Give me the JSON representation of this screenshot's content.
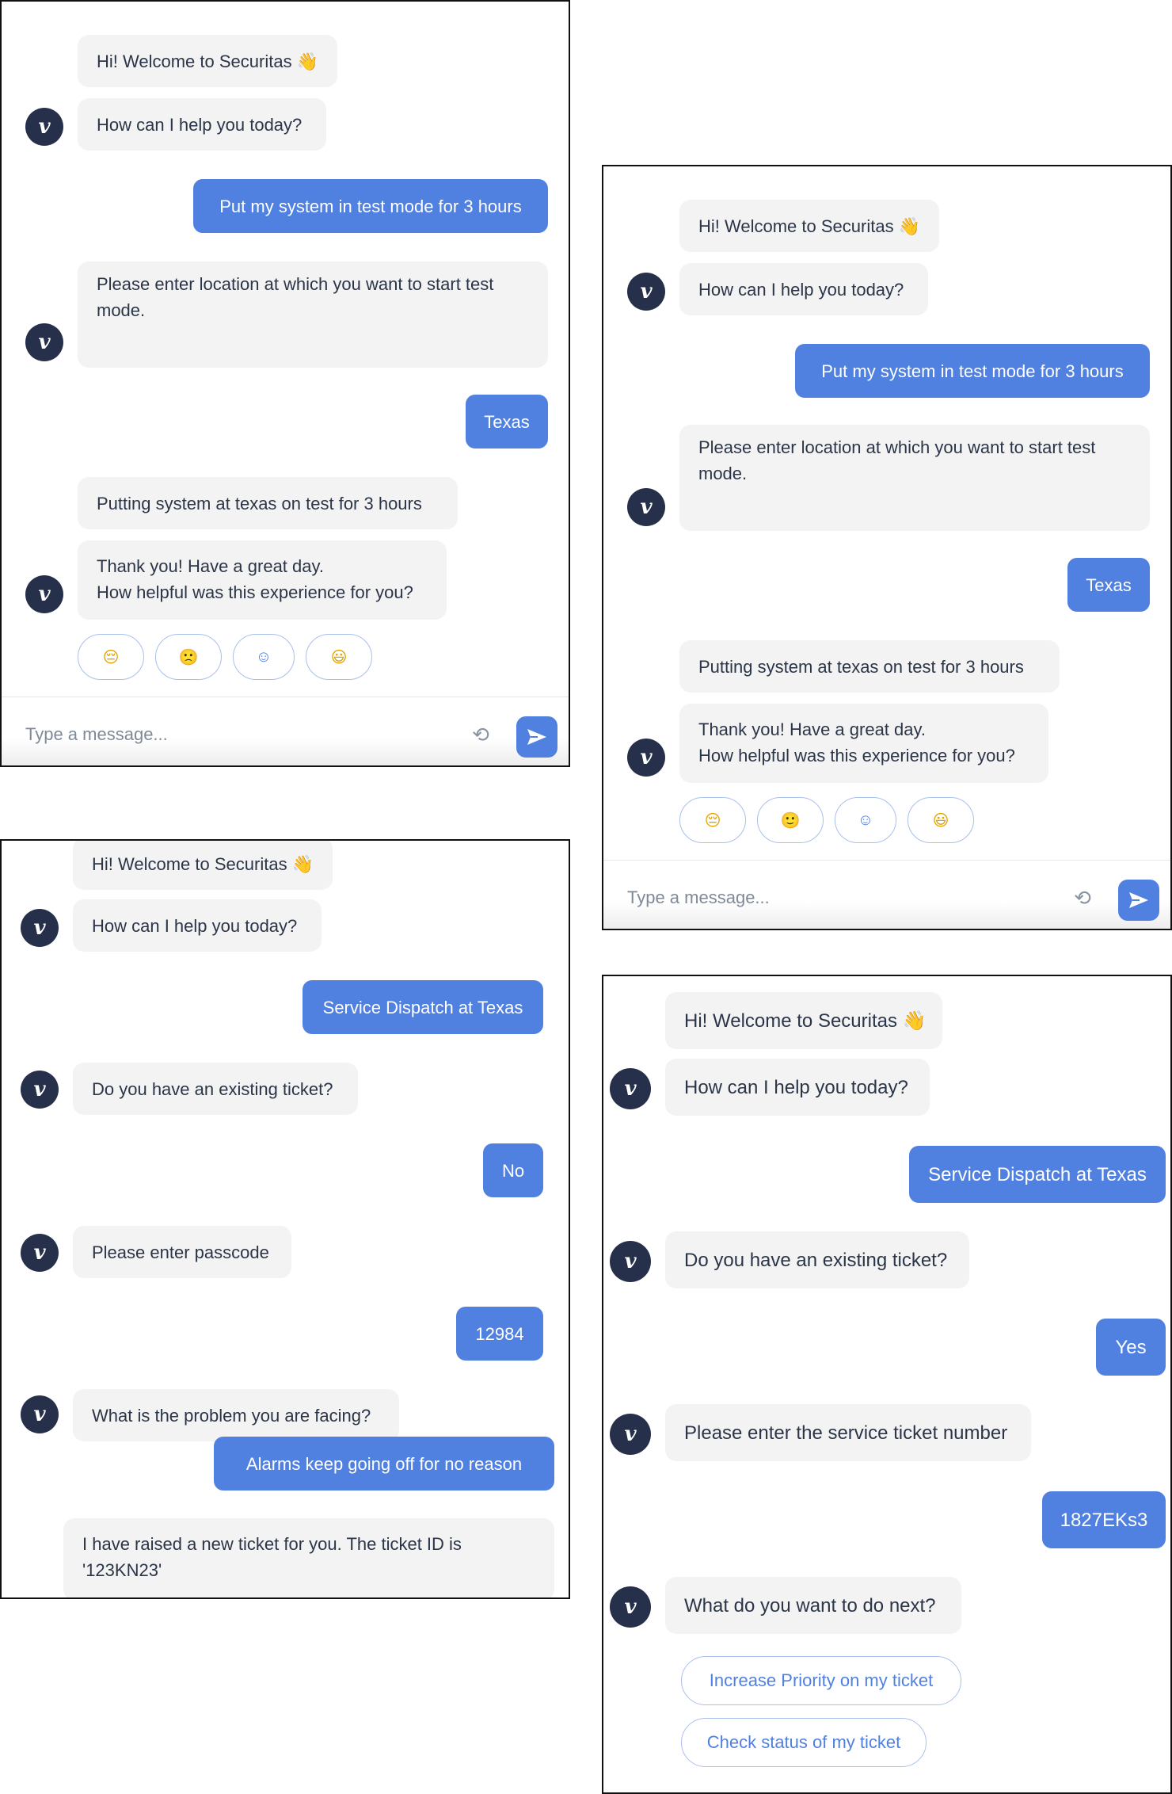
{
  "colors": {
    "user_bubble": "#5081e0",
    "bot_bubble": "#f3f3f3",
    "avatar": "#27304a",
    "option_border": "#a9c0ec"
  },
  "avatar_icon": "v-logo-icon",
  "composer": {
    "placeholder": "Type a message...",
    "refresh_icon": "refresh-icon",
    "send_icon": "send-icon"
  },
  "panel1": {
    "messages": [
      {
        "sender": "bot",
        "text": "Hi! Welcome to Securitas 👋"
      },
      {
        "sender": "bot",
        "text": "How can I help you today?"
      },
      {
        "sender": "user",
        "text": "Put my system in test mode for 3 hours"
      },
      {
        "sender": "bot",
        "text": "Please enter location at which you want to start test mode."
      },
      {
        "sender": "user",
        "text": "Texas"
      },
      {
        "sender": "bot",
        "text": "Putting system at texas on test for 3 hours"
      },
      {
        "sender": "bot",
        "line1": "Thank you! Have a great day.",
        "line2": "How helpful was this experience for you?"
      }
    ],
    "ratings": [
      "😔",
      "🙁",
      "☺",
      "😃"
    ]
  },
  "panel2": {
    "messages": [
      {
        "sender": "bot",
        "text": "Hi! Welcome to Securitas 👋"
      },
      {
        "sender": "bot",
        "text": "How can I help you today?"
      },
      {
        "sender": "user",
        "text": "Put my system in test mode for 3 hours"
      },
      {
        "sender": "bot",
        "text": "Please enter location at which you want to start test mode."
      },
      {
        "sender": "user",
        "text": "Texas"
      },
      {
        "sender": "bot",
        "text": "Putting system at texas on test for 3 hours"
      },
      {
        "sender": "bot",
        "line1": "Thank you! Have a great day.",
        "line2": "How helpful was this experience for you?"
      }
    ],
    "ratings": [
      "😔",
      "🙂",
      "☺",
      "😃"
    ]
  },
  "panel3": {
    "messages": [
      {
        "sender": "bot",
        "text": "Hi! Welcome to Securitas 👋"
      },
      {
        "sender": "bot",
        "text": "How can I help you today?"
      },
      {
        "sender": "user",
        "text": "Service Dispatch at Texas"
      },
      {
        "sender": "bot",
        "text": "Do you have an existing ticket?"
      },
      {
        "sender": "user",
        "text": "No"
      },
      {
        "sender": "bot",
        "text": "Please enter passcode"
      },
      {
        "sender": "user",
        "text": "12984"
      },
      {
        "sender": "bot",
        "text": "What is the problem you are facing?"
      },
      {
        "sender": "user",
        "text": "Alarms keep going off for no reason"
      },
      {
        "sender": "bot",
        "text": "I have raised a new ticket for you. The ticket ID is '123KN23'"
      }
    ]
  },
  "panel4": {
    "messages": [
      {
        "sender": "bot",
        "text": "Hi! Welcome to Securitas 👋"
      },
      {
        "sender": "bot",
        "text": "How can I help you today?"
      },
      {
        "sender": "user",
        "text": "Service Dispatch at Texas"
      },
      {
        "sender": "bot",
        "text": "Do you have an existing ticket?"
      },
      {
        "sender": "user",
        "text": "Yes"
      },
      {
        "sender": "bot",
        "text": "Please enter the service ticket number"
      },
      {
        "sender": "user",
        "text": "1827EKs3"
      },
      {
        "sender": "bot",
        "text": "What do you want to do next?"
      }
    ],
    "options": [
      "Increase Priority on my ticket",
      "Check status of my ticket"
    ]
  }
}
